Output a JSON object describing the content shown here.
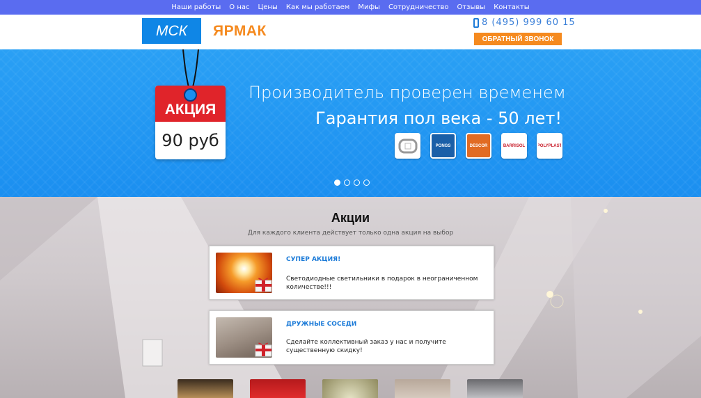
{
  "nav": [
    "Наши работы",
    "О нас",
    "Цены",
    "Как мы работаем",
    "Мифы",
    "Сотрудничество",
    "Отзывы",
    "Контакты"
  ],
  "header": {
    "logo_city": "МСК",
    "logo_brand": "ЯРМАК",
    "phone": "8 (495) 999 60 15",
    "callback_label": "ОБРАТНЫЙ ЗВОНОК"
  },
  "hero": {
    "tag_label": "АКЦИЯ",
    "tag_price": "90 руб",
    "line1": "Производитель проверен временем",
    "line2": "Гарантия пол века - 50 лет!",
    "brands": [
      "CLIPSO",
      "PONGS",
      "DESCOR",
      "BARRISOL",
      "POLYPLAST"
    ],
    "slides": 4,
    "active_slide": 1
  },
  "promo": {
    "title": "Акции",
    "subtitle": "Для каждого клиента действует только одна акция на выбор",
    "cards": [
      {
        "title": "СУПЕР АКЦИЯ!",
        "text": "Светодиодные светильники в подарок в неограниченном количестве!!!"
      },
      {
        "title": "ДРУЖНЫЕ СОСЕДИ",
        "text": "Сделайте коллективный заказ у нас и получите существенную скидку!"
      }
    ]
  },
  "colors": {
    "nav_bg": "#5a6cf0",
    "accent_blue": "#0f86e6",
    "accent_orange": "#f58a1f",
    "tag_red": "#e0242a"
  }
}
